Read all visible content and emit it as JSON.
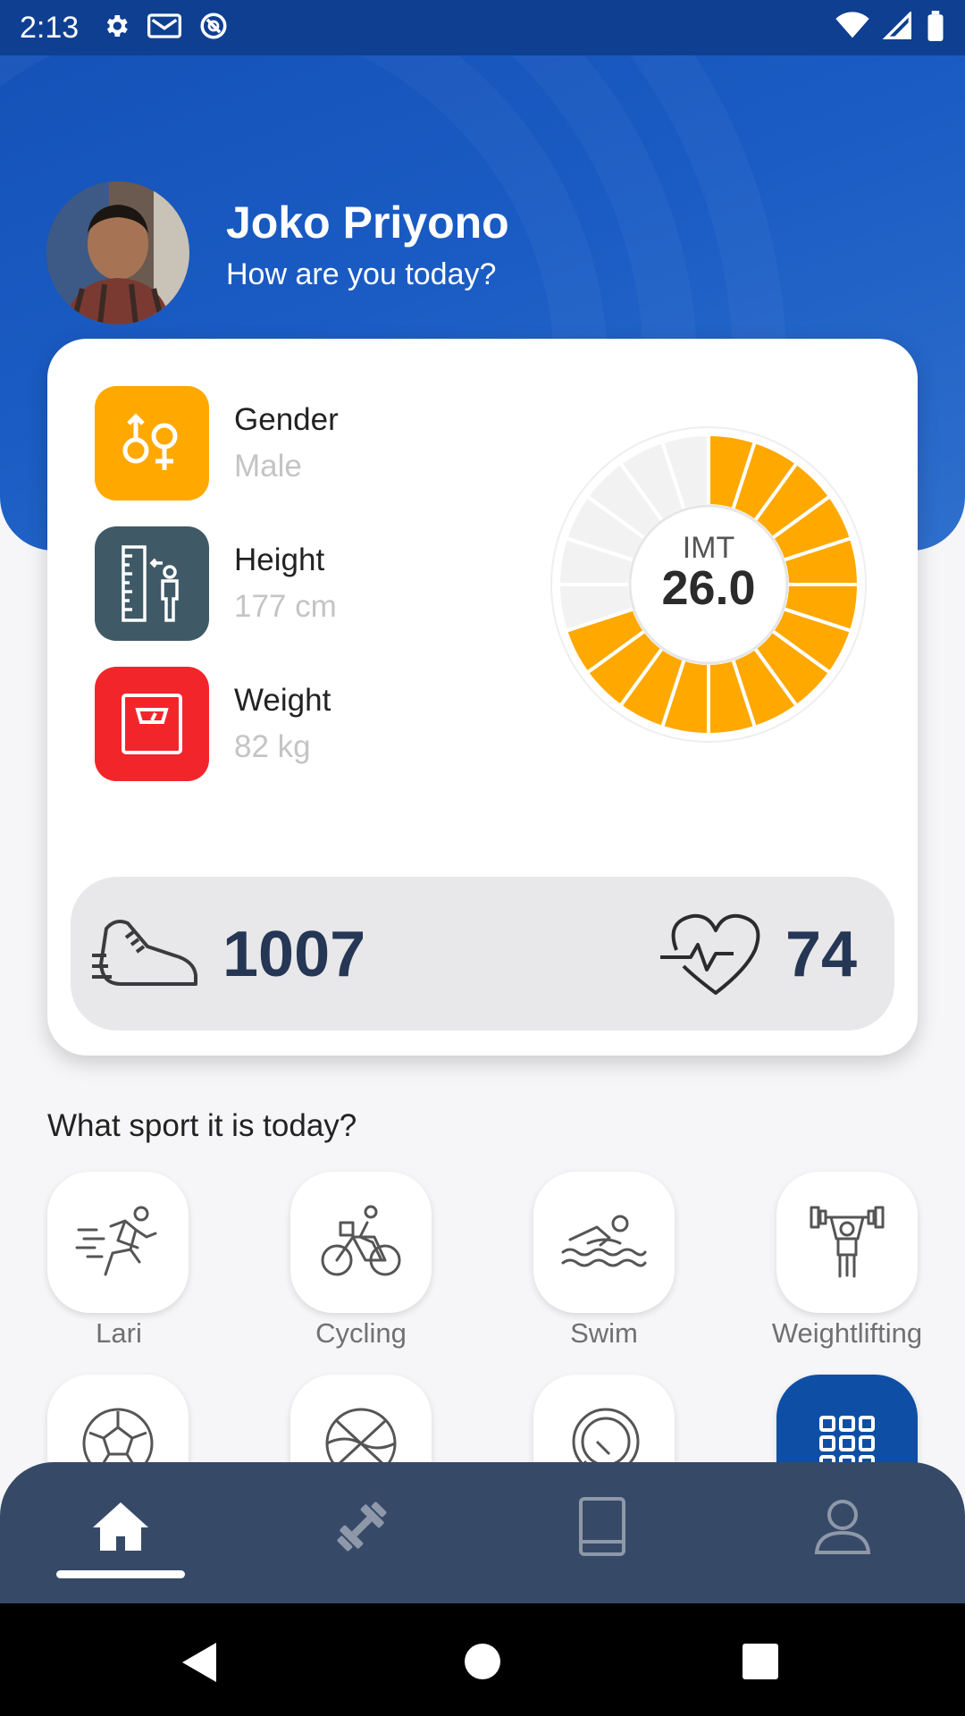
{
  "status_bar": {
    "time": "2:13",
    "left_icons": [
      "gear-icon",
      "gmail-icon",
      "sync-icon"
    ],
    "right_icons": [
      "wifi-icon",
      "signal-icon",
      "battery-icon"
    ]
  },
  "header": {
    "user_name": "Joko Priyono",
    "greeting": "How are you today?"
  },
  "profile": {
    "items": [
      {
        "label": "Gender",
        "value": "Male",
        "icon": "gender-icon",
        "color": "#FFA800"
      },
      {
        "label": "Height",
        "value": "177 cm",
        "icon": "height-ruler-icon",
        "color": "#3F5A66"
      },
      {
        "label": "Weight",
        "value": "82 kg",
        "icon": "scale-icon",
        "color": "#F2262A"
      }
    ]
  },
  "imt": {
    "label": "IMT",
    "value": "26.0",
    "filled_fraction": 0.7,
    "active_color": "#FFA800",
    "inactive_color": "#F2F2F2"
  },
  "stats": {
    "steps": "1007",
    "heart_rate": "74"
  },
  "sports": {
    "title": "What sport it is today?",
    "items": [
      {
        "label": "Lari",
        "icon": "running-icon"
      },
      {
        "label": "Cycling",
        "icon": "cycling-icon"
      },
      {
        "label": "Swim",
        "icon": "swimming-icon"
      },
      {
        "label": "Weightlifting",
        "icon": "weightlifting-icon"
      },
      {
        "label": "",
        "icon": "soccer-ball-icon"
      },
      {
        "label": "",
        "icon": "basketball-icon"
      },
      {
        "label": "",
        "icon": "ping-pong-icon"
      },
      {
        "label": "",
        "icon": "grid-menu-icon"
      }
    ]
  },
  "bottom_nav": {
    "active": "home",
    "items": [
      "home-icon",
      "dumbbell-icon",
      "book-icon",
      "profile-icon"
    ]
  },
  "colors": {
    "primary": "#1552B8",
    "nav_bg": "#364A68",
    "stat_text": "#263655"
  }
}
